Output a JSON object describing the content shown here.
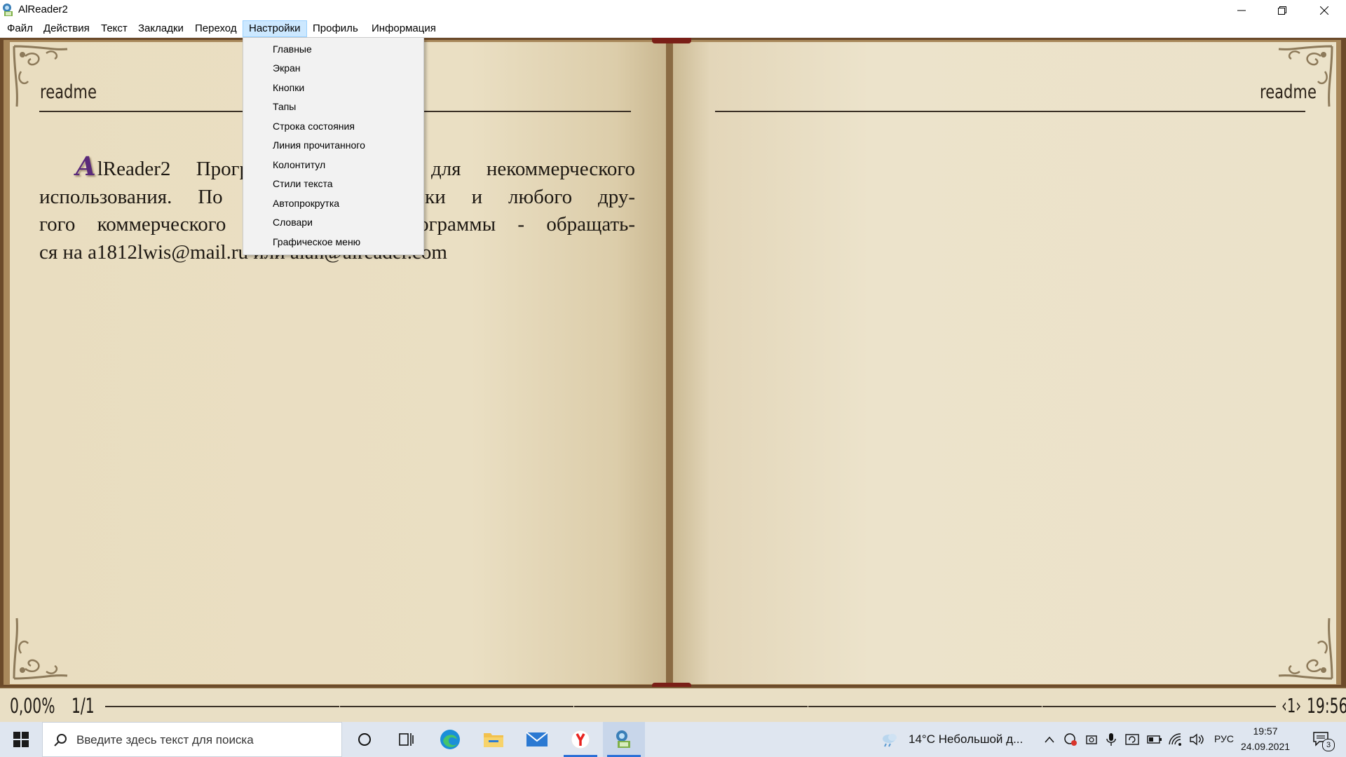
{
  "window": {
    "title": "AlReader2"
  },
  "menu": {
    "items": [
      "Файл",
      "Действия",
      "Текст",
      "Закладки",
      "Переход",
      "Настройки",
      "Профиль",
      "Информация"
    ],
    "active": "Настройки"
  },
  "settings_dropdown": {
    "items": [
      "Главные",
      "Экран",
      "Кнопки",
      "Тапы",
      "Строка состояния",
      "Линия прочитанного",
      "Колонтитул",
      "Стили текста",
      "Автопрокрутка",
      "Словари",
      "Графическое меню"
    ]
  },
  "book": {
    "header_left": "readme",
    "header_right": "readme",
    "dropcap": "A",
    "lines": [
      "lReader2 Программа бесплатна для некоммерческого",
      "использования. По вопросам установки и любого дру-",
      "гого коммерческого использования программы - обращать-",
      "ся на a1812lwis@mail.ru или alan@alreader.com"
    ]
  },
  "status": {
    "percent": "0,00%",
    "page": "1/1",
    "nav": "‹1›",
    "clock": "19:56"
  },
  "taskbar": {
    "search_placeholder": "Введите здесь текст для поиска",
    "weather": "14°C  Небольшой д...",
    "language": "РУС",
    "time": "19:57",
    "date": "24.09.2021",
    "notification_count": "3"
  },
  "colors": {
    "page": "#eadfc3",
    "frame": "#6b4a2a",
    "menu_highlight": "#cce8ff",
    "dropcap": "#5a2a7a",
    "taskbar": "#dfe6f0"
  }
}
